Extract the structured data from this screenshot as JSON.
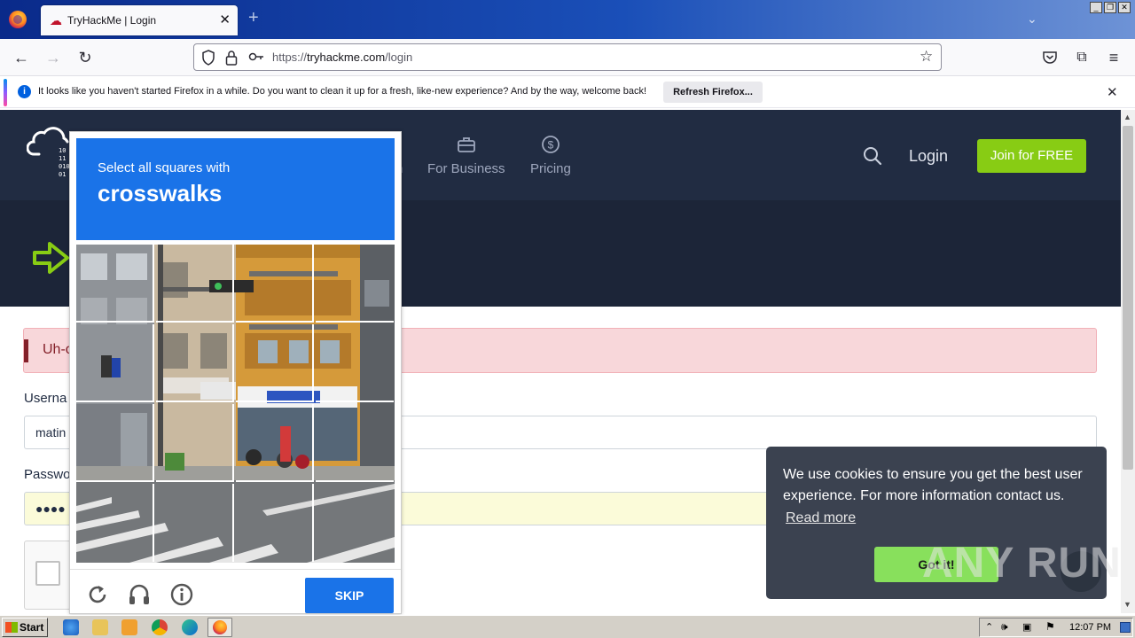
{
  "browser": {
    "tab_title": "TryHackMe | Login",
    "url_prefix": "https://",
    "url_domain": "tryhackme.com",
    "url_path": "/login",
    "notification_text": "It looks like you haven't started Firefox in a while. Do you want to clean it up for a fresh, like-new experience? And by the way, welcome back!",
    "refresh_label": "Refresh Firefox..."
  },
  "site": {
    "logo_bits": [
      "10",
      "11",
      "010",
      "01"
    ],
    "menu": [
      {
        "label": "n",
        "icon": "hidden"
      },
      {
        "label": "For Business",
        "icon": "briefcase-icon"
      },
      {
        "label": "Pricing",
        "icon": "dollar-icon"
      }
    ],
    "login_label": "Login",
    "join_label": "Join for FREE",
    "brand_green": "#88cc14",
    "header_bg": "#212c42"
  },
  "form": {
    "alert_text": "Uh-o",
    "username_label": "Userna",
    "username_value": "matin",
    "password_label": "Passwo",
    "password_value": "●●●●"
  },
  "captcha": {
    "instruction": "Select all squares with",
    "target": "crosswalks",
    "skip_label": "SKIP",
    "accent": "#1a73e8"
  },
  "cookie": {
    "text": "We use cookies to ensure you get the best user experience. For more information contact us.",
    "read_more": "Read more",
    "accept_label": "Got it!"
  },
  "watermark": "ANY RUN",
  "taskbar": {
    "start_label": "Start",
    "clock": "12:07 PM"
  }
}
